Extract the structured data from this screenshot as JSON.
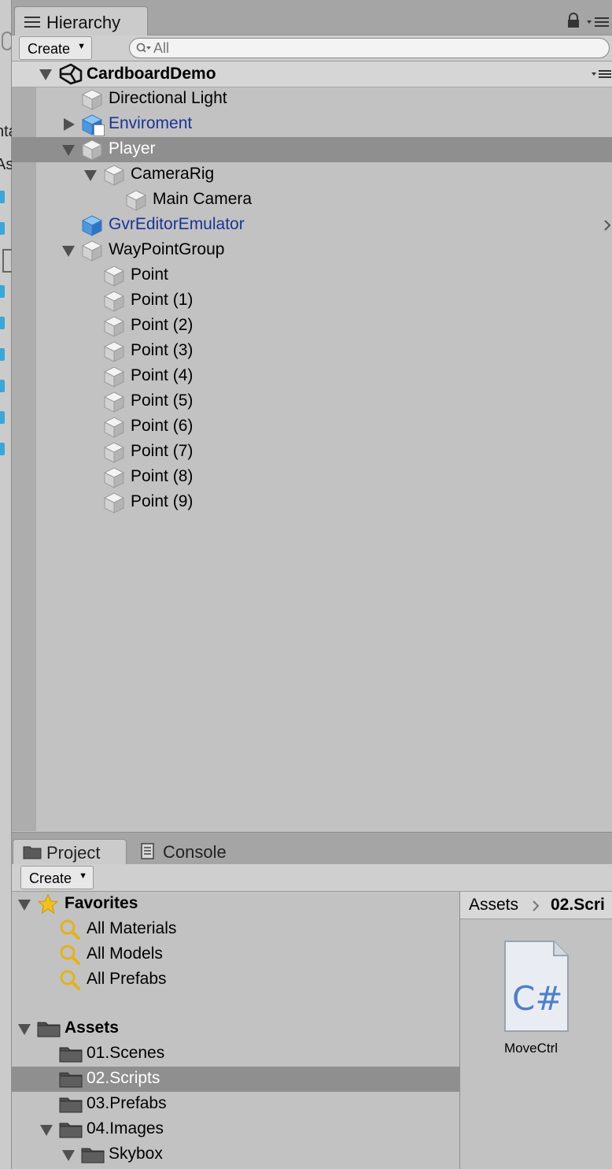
{
  "hierarchy": {
    "tab_label": "Hierarchy",
    "create_label": "Create",
    "search_placeholder": "All",
    "scene_name": "CardboardDemo",
    "items": [
      {
        "label": "Directional Light"
      },
      {
        "label": "Enviroment"
      },
      {
        "label": "Player"
      },
      {
        "label": "CameraRig"
      },
      {
        "label": "Main Camera"
      },
      {
        "label": "GvrEditorEmulator"
      },
      {
        "label": "WayPointGroup"
      },
      {
        "label": "Point"
      },
      {
        "label": "Point (1)"
      },
      {
        "label": "Point (2)"
      },
      {
        "label": "Point (3)"
      },
      {
        "label": "Point (4)"
      },
      {
        "label": "Point (5)"
      },
      {
        "label": "Point (6)"
      },
      {
        "label": "Point (7)"
      },
      {
        "label": "Point (8)"
      },
      {
        "label": "Point (9)"
      }
    ]
  },
  "left_panel": {
    "fragments": [
      "nta",
      "As"
    ]
  },
  "project": {
    "tabs": [
      {
        "label": "Project"
      },
      {
        "label": "Console"
      }
    ],
    "create_label": "Create",
    "favorites": {
      "label": "Favorites",
      "items": [
        {
          "label": "All Materials"
        },
        {
          "label": "All Models"
        },
        {
          "label": "All Prefabs"
        }
      ]
    },
    "assets": {
      "label": "Assets",
      "items": [
        {
          "label": "01.Scenes"
        },
        {
          "label": "02.Scripts"
        },
        {
          "label": "03.Prefabs"
        },
        {
          "label": "04.Images"
        },
        {
          "label": "Skybox"
        }
      ]
    },
    "breadcrumb": {
      "root": "Assets",
      "current": "02.Scri"
    },
    "file": {
      "name": "MoveCtrl",
      "icon_text": "C#"
    }
  },
  "colors": {
    "selection": "#8f8f8f",
    "prefab_text": "#1a3497",
    "panel_bg": "#c2c2c2"
  }
}
